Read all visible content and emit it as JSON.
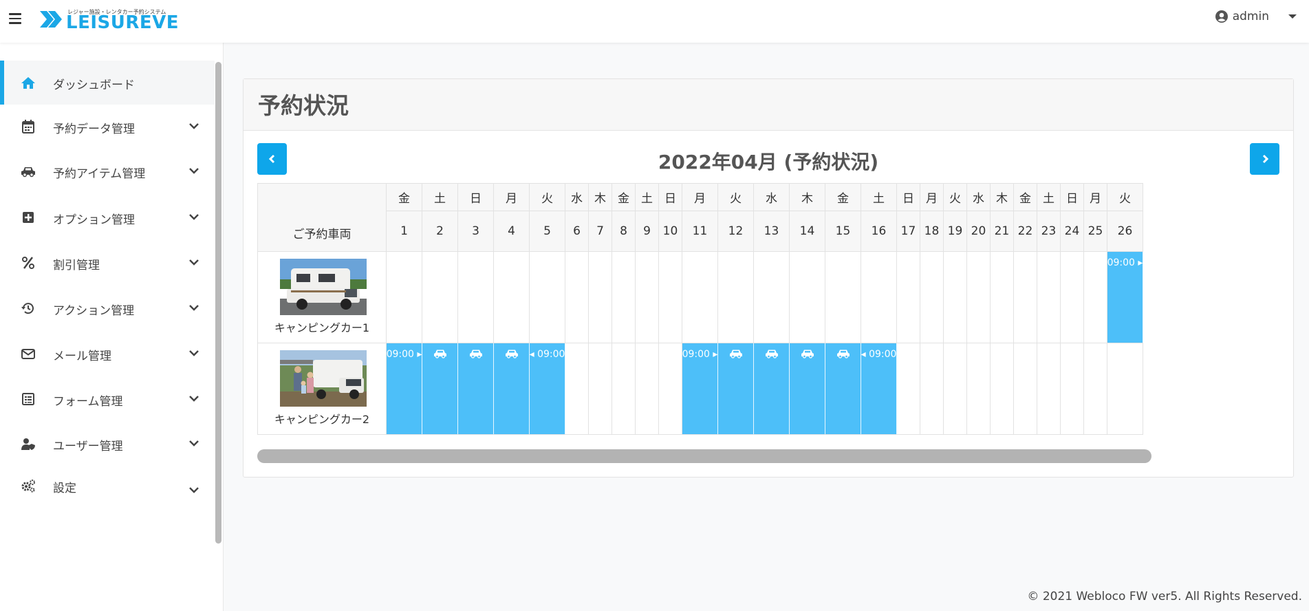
{
  "app": {
    "logo_sub": "レジャー施設・レンタカー予約システム",
    "logo_text": "LEISUREVE",
    "user": "admin",
    "accent": "#1ba7e6",
    "booking_color": "#4dbff9"
  },
  "sidebar": {
    "items": [
      {
        "label": "ダッシュボード",
        "icon": "home-icon",
        "active": true
      },
      {
        "label": "予約データ管理",
        "icon": "calendar-icon"
      },
      {
        "label": "予約アイテム管理",
        "icon": "car-icon"
      },
      {
        "label": "オプション管理",
        "icon": "plus-square-icon"
      },
      {
        "label": "割引管理",
        "icon": "percent-icon"
      },
      {
        "label": "アクション管理",
        "icon": "history-icon"
      },
      {
        "label": "メール管理",
        "icon": "envelope-icon"
      },
      {
        "label": "フォーム管理",
        "icon": "form-icon"
      },
      {
        "label": "ユーザー管理",
        "icon": "user-shield-icon"
      },
      {
        "label": "設定",
        "icon": "gears-icon"
      }
    ]
  },
  "panel": {
    "title": "予約状況",
    "month_title": "2022年04月 (予約状況)",
    "vehicle_col_header": "ご予約車両",
    "prev_icon": "chevron-left-icon",
    "next_icon": "chevron-right-icon"
  },
  "calendar": {
    "days": [
      {
        "d": "1",
        "w": "金"
      },
      {
        "d": "2",
        "w": "土"
      },
      {
        "d": "3",
        "w": "日"
      },
      {
        "d": "4",
        "w": "月"
      },
      {
        "d": "5",
        "w": "火"
      },
      {
        "d": "6",
        "w": "水"
      },
      {
        "d": "7",
        "w": "木"
      },
      {
        "d": "8",
        "w": "金"
      },
      {
        "d": "9",
        "w": "土"
      },
      {
        "d": "10",
        "w": "日"
      },
      {
        "d": "11",
        "w": "月"
      },
      {
        "d": "12",
        "w": "火"
      },
      {
        "d": "13",
        "w": "水"
      },
      {
        "d": "14",
        "w": "木"
      },
      {
        "d": "15",
        "w": "金"
      },
      {
        "d": "16",
        "w": "土"
      },
      {
        "d": "17",
        "w": "日"
      },
      {
        "d": "18",
        "w": "月"
      },
      {
        "d": "19",
        "w": "火"
      },
      {
        "d": "20",
        "w": "水"
      },
      {
        "d": "21",
        "w": "木"
      },
      {
        "d": "22",
        "w": "金"
      },
      {
        "d": "23",
        "w": "土"
      },
      {
        "d": "24",
        "w": "日"
      },
      {
        "d": "25",
        "w": "月"
      },
      {
        "d": "26",
        "w": "火"
      }
    ],
    "vehicles": [
      {
        "name": "キャンピングカー1",
        "bookings": [
          {
            "day": "26",
            "label": "09:00",
            "kind": "start"
          }
        ]
      },
      {
        "name": "キャンピングカー2",
        "bookings": [
          {
            "day": "1",
            "label": "09:00",
            "kind": "start"
          },
          {
            "day": "2",
            "kind": "middle"
          },
          {
            "day": "3",
            "kind": "middle"
          },
          {
            "day": "4",
            "kind": "middle"
          },
          {
            "day": "5",
            "label": "09:00",
            "kind": "end"
          },
          {
            "day": "11",
            "label": "09:00",
            "kind": "start"
          },
          {
            "day": "12",
            "kind": "middle"
          },
          {
            "day": "13",
            "kind": "middle"
          },
          {
            "day": "14",
            "kind": "middle"
          },
          {
            "day": "15",
            "kind": "middle"
          },
          {
            "day": "16",
            "label": "09:00",
            "kind": "end"
          }
        ]
      }
    ]
  },
  "footer": "© 2021 Webloco FW ver5. All Rights Reserved."
}
